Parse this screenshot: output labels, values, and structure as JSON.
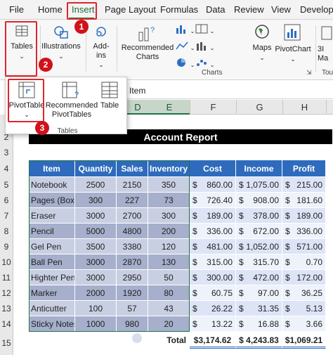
{
  "ribbon_tabs": [
    "File",
    "Home",
    "Insert",
    "Page Layout",
    "Formulas",
    "Data",
    "Review",
    "View",
    "Develope"
  ],
  "ribbon": {
    "tables_label": "Tables",
    "illustrations_label": "Illustrations",
    "addins_label": "Add-\nins",
    "recommended_charts_label": "Recommended\nCharts",
    "maps_label": "Maps",
    "pivotchart_label": "PivotChart",
    "partial_3d_label": "3I\nMa",
    "charts_group": "Charts",
    "tours_group_partial": "Tou"
  },
  "tables_popup": {
    "pivottable_label": "PivotTable",
    "recommended_pivottables_label": "Recommended\nPivotTables",
    "table_label": "Table",
    "group_label": "Tables"
  },
  "callouts": [
    "1",
    "2",
    "3"
  ],
  "formula_bar_value": "Item",
  "column_headers": [
    "D",
    "E",
    "F",
    "G",
    "H"
  ],
  "row_numbers": [
    "2",
    "3",
    "4",
    "5",
    "6",
    "7",
    "8",
    "9",
    "10",
    "11",
    "12",
    "13",
    "14",
    "15"
  ],
  "report_title": "Account Report",
  "table": {
    "headers": [
      "Item",
      "Quantity",
      "Sales",
      "Inventory",
      "Cost",
      "Income",
      "Profit"
    ],
    "rows": [
      [
        "Notebook",
        "2500",
        "2150",
        "350",
        "860.00",
        "1,075.00",
        "215.00"
      ],
      [
        "Pages (Box)",
        "300",
        "227",
        "73",
        "726.40",
        "908.00",
        "181.60"
      ],
      [
        "Eraser",
        "3000",
        "2700",
        "300",
        "189.00",
        "378.00",
        "189.00"
      ],
      [
        "Pencil",
        "5000",
        "4800",
        "200",
        "336.00",
        "672.00",
        "336.00"
      ],
      [
        "Gel Pen",
        "3500",
        "3380",
        "120",
        "481.00",
        "1,052.00",
        "571.00"
      ],
      [
        "Ball Pen",
        "3000",
        "2870",
        "130",
        "315.00",
        "315.70",
        "0.70"
      ],
      [
        "Highter Pen",
        "3000",
        "2950",
        "50",
        "300.00",
        "472.00",
        "172.00"
      ],
      [
        "Marker",
        "2000",
        "1920",
        "80",
        "60.75",
        "97.00",
        "36.25"
      ],
      [
        "Anticutter",
        "100",
        "57",
        "43",
        "26.22",
        "31.35",
        "5.13"
      ],
      [
        "Sticky Notes",
        "1000",
        "980",
        "20",
        "13.22",
        "16.88",
        "3.66"
      ]
    ],
    "currency_symbol": "$",
    "total_label": "Total",
    "totals": [
      "$3,174.62",
      "$ 4,243.83",
      "$1,069.21"
    ]
  },
  "colors": {
    "highlight": "#e0242e",
    "header_blue": "#2e6bbd",
    "title_bg": "#000000",
    "green_accent": "#217346"
  }
}
